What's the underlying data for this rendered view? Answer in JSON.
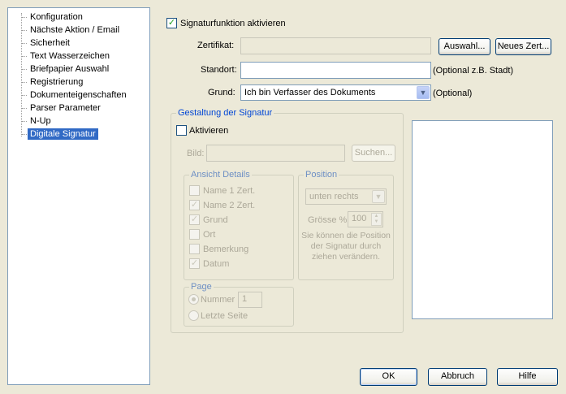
{
  "tree": {
    "items": [
      {
        "label": "Konfiguration"
      },
      {
        "label": "Nächste Aktion / Email"
      },
      {
        "label": "Sicherheit"
      },
      {
        "label": "Text Wasserzeichen"
      },
      {
        "label": "Briefpapier Auswahl"
      },
      {
        "label": "Registrierung"
      },
      {
        "label": "Dokumenteigenschaften"
      },
      {
        "label": "Parser Parameter"
      },
      {
        "label": "N-Up"
      },
      {
        "label": "Digitale Signatur",
        "selected": true
      }
    ]
  },
  "signature": {
    "enable_label": "Signaturfunktion aktivieren",
    "enabled": true,
    "certificate_label": "Zertifikat:",
    "certificate_value": "",
    "browse_button": "Auswahl...",
    "new_cert_button": "Neues Zert...",
    "location_label": "Standort:",
    "location_value": "",
    "location_hint": "(Optional z.B. Stadt)",
    "reason_label": "Grund:",
    "reason_value": "Ich bin Verfasser des Dokuments",
    "reason_hint": "(Optional)"
  },
  "design": {
    "title": "Gestaltung der Signatur",
    "activate_label": "Aktivieren",
    "activated": false,
    "image_label": "Bild:",
    "image_value": "",
    "search_button": "Suchen...",
    "details": {
      "title": "Ansicht Details",
      "items": [
        {
          "label": "Name 1 Zert.",
          "checked": false
        },
        {
          "label": "Name 2 Zert.",
          "checked": true
        },
        {
          "label": "Grund",
          "checked": true
        },
        {
          "label": "Ort",
          "checked": false
        },
        {
          "label": "Bemerkung",
          "checked": false
        },
        {
          "label": "Datum",
          "checked": true
        }
      ]
    },
    "position": {
      "title": "Position",
      "selected": "unten rechts",
      "size_label": "Grösse %:",
      "size_value": "100",
      "hint": "Sie können die Position der Signatur durch ziehen verändern."
    },
    "page": {
      "title": "Page",
      "number_label": "Nummer",
      "number_value": "1",
      "last_label": "Letzte Seite",
      "selected": "number"
    }
  },
  "footer": {
    "ok": "OK",
    "cancel": "Abbruch",
    "help": "Hilfe"
  }
}
